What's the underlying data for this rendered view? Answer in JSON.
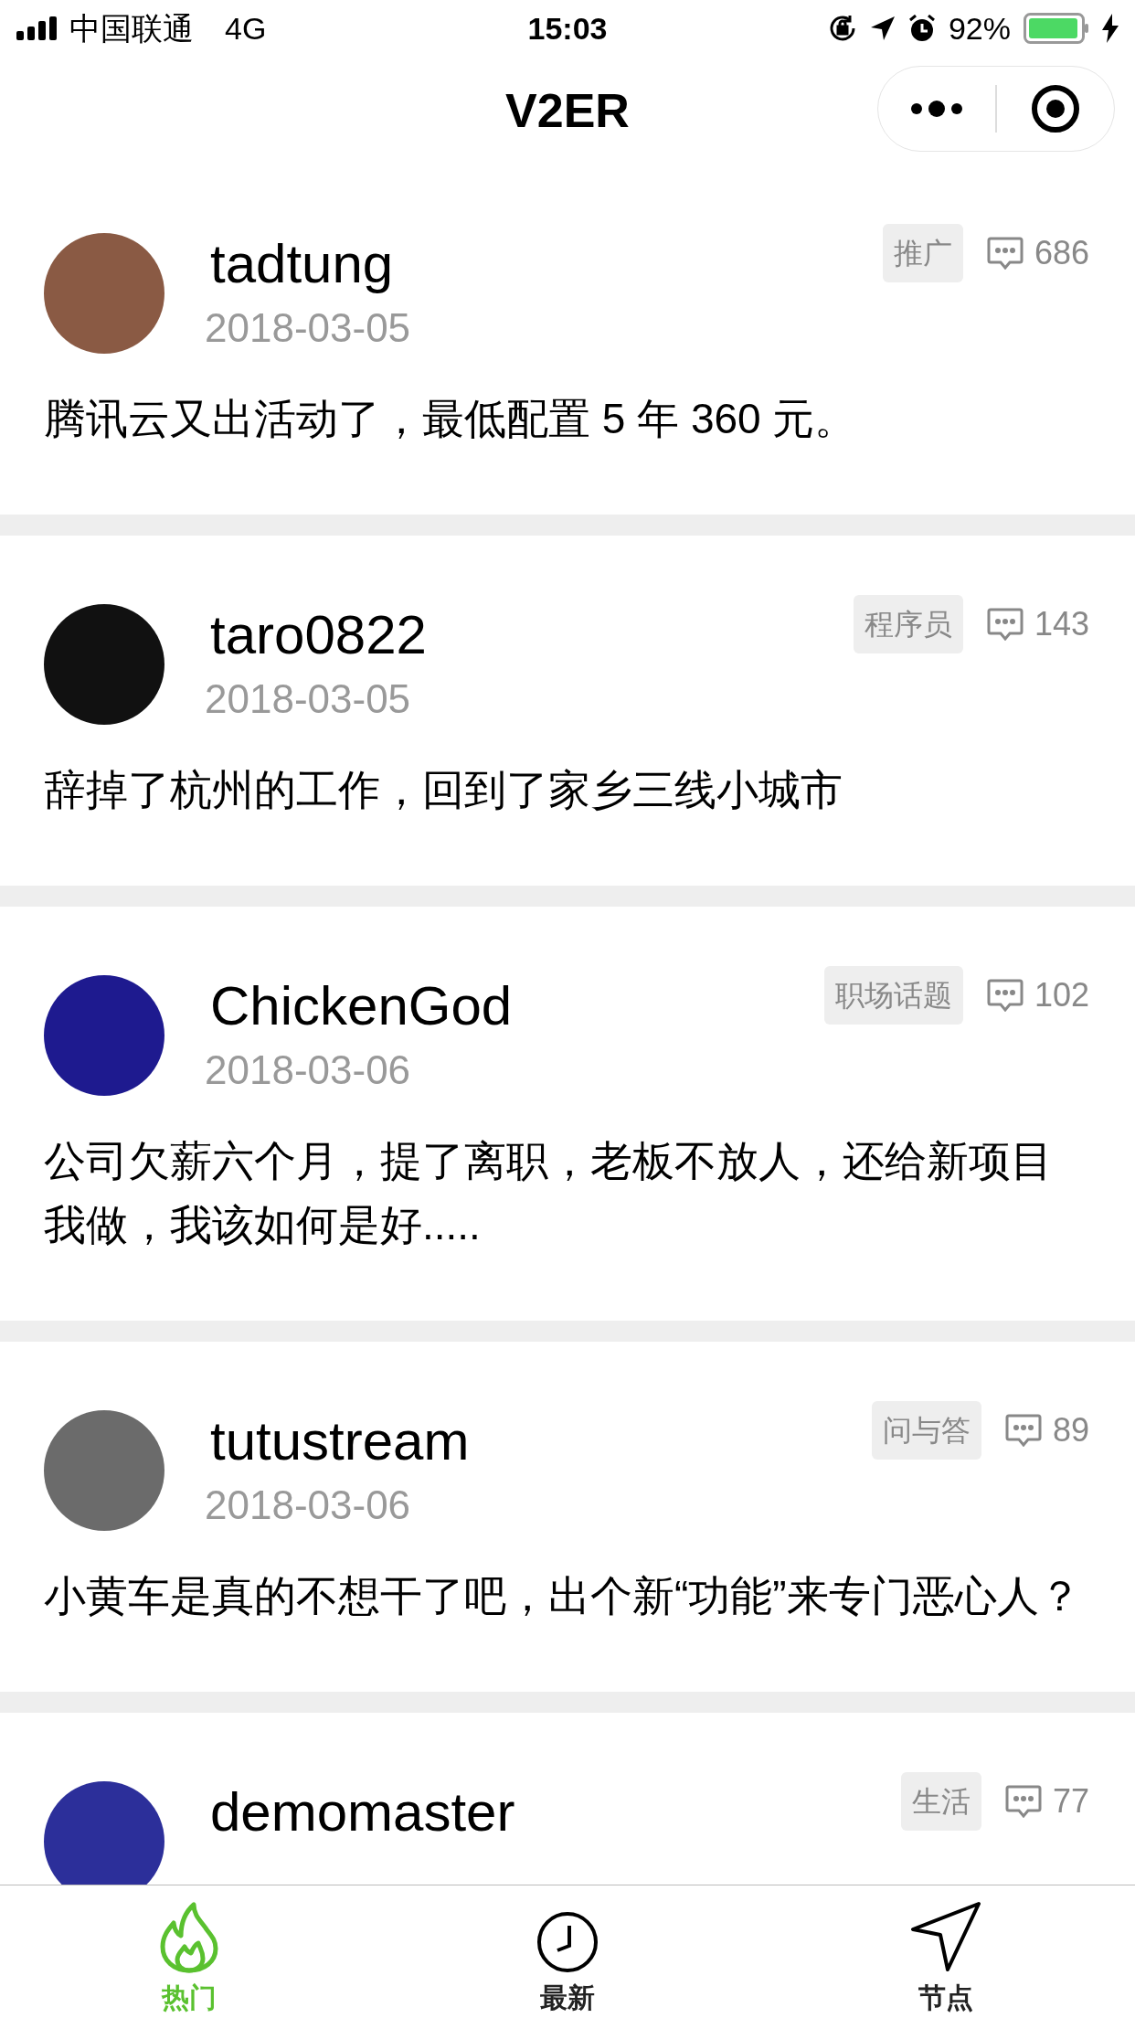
{
  "status_bar": {
    "carrier": "中国联通",
    "network": "4G",
    "time": "15:03",
    "battery": "92%"
  },
  "nav_bar": {
    "title": "V2ER"
  },
  "posts": [
    {
      "username": "tadtung",
      "date": "2018-03-05",
      "tag": "推广",
      "comments": "686",
      "title": "腾讯云又出活动了，最低配置 5 年 360 元。"
    },
    {
      "username": "taro0822",
      "date": "2018-03-05",
      "tag": "程序员",
      "comments": "143",
      "title": "辞掉了杭州的工作，回到了家乡三线小城市"
    },
    {
      "username": "ChickenGod",
      "date": "2018-03-06",
      "tag": "职场话题",
      "comments": "102",
      "title": "公司欠薪六个月，提了离职，老板不放人，还给新项目我做，我该如何是好....."
    },
    {
      "username": "tutustream",
      "date": "2018-03-06",
      "tag": "问与答",
      "comments": "89",
      "title": "小黄车是真的不想干了吧，出个新“功能”来专门恶心人？"
    },
    {
      "username": "demomaster",
      "tag": "生活",
      "comments": "77"
    }
  ],
  "tab_bar": [
    {
      "label": "热门",
      "selected": true
    },
    {
      "label": "最新",
      "selected": false
    },
    {
      "label": "节点",
      "selected": false
    }
  ]
}
